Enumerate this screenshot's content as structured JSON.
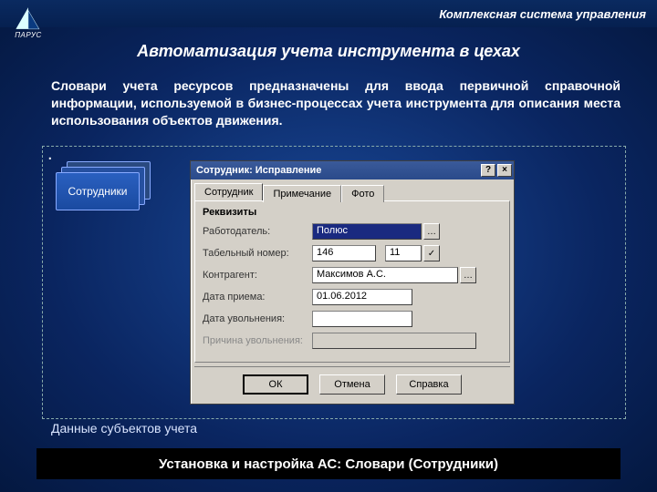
{
  "header": {
    "system_text": "Комплексная система управления",
    "logo_text": "ПАРУС"
  },
  "title": "Автоматизация учета инструмента в цехах",
  "desc": "Словари учета ресурсов предназначены для ввода первичной справочной информации, используемой в бизнес-процессах учета инструмента для описания места использования объектов движения.",
  "card_label": "Сотрудники",
  "data_area_label": "Данные субъектов учета",
  "footer": "Установка и настройка АС: Словари (Сотрудники)",
  "dialog": {
    "title": "Сотрудник: Исправление",
    "help_btn": "?",
    "close_btn": "×",
    "tabs": {
      "t1": "Сотрудник",
      "t2": "Примечание",
      "t3": "Фото"
    },
    "group": "Реквизиты",
    "labels": {
      "employer": "Работодатель:",
      "tabnum": "Табельный номер:",
      "agent": "Контрагент:",
      "hire": "Дата приема:",
      "fire": "Дата увольнения:",
      "reason": "Причина увольнения:"
    },
    "values": {
      "employer": "Полюс",
      "tabnum_a": "146",
      "tabnum_b": "11",
      "agent": "Максимов А.С.",
      "hire": "01.06.2012",
      "fire": "",
      "reason": ""
    },
    "ellipsis": "…",
    "check": "✓",
    "buttons": {
      "ok": "ОК",
      "cancel": "Отмена",
      "help": "Справка"
    }
  }
}
